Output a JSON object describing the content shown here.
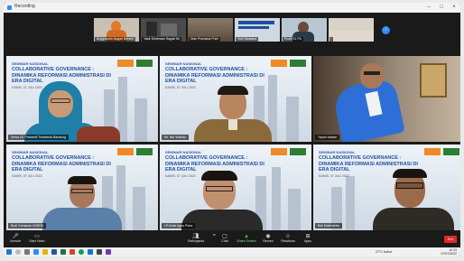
{
  "window": {
    "title": "Recording"
  },
  "strip": {
    "participants": [
      "Anggrandis Nagari Berseri",
      "Yasir Seneraan Sagati Se",
      "Dian Pramana Putri",
      "Yuni Dwisaka",
      "Prodi S1 PA",
      ""
    ]
  },
  "slide": {
    "seminar": "SEMINAR NASIONAL",
    "title": "COLLABORATIVE GOVERNANCE : DINAMIKA REFORMASI ADMINISTRASI DI ERA DIGITAL",
    "date": "KAMIS, 07 JULI 2022"
  },
  "tiles": [
    {
      "name": "Dewa Gt. Pramesti Tristwinda Bandung"
    },
    {
      "name": "Mr. Nur Widodo"
    },
    {
      "name": "Yayan Irawan"
    },
    {
      "name": "Budi Gunawan UNSRA"
    },
    {
      "name": "LR Anak Agus Putra"
    },
    {
      "name": "Bali Makisdeba"
    }
  ],
  "toolbar": {
    "unmute": "Unmute",
    "start_video": "Start Video",
    "participants": "Participants",
    "participants_count": "70",
    "chat": "Chat",
    "share_screen": "Share Screen",
    "record": "Record",
    "reactions": "Reactions",
    "apps": "Apps",
    "end": "End"
  },
  "taskbar": {
    "weather": "27°C Kabut",
    "time": "10:23",
    "date": "07/07/2022"
  },
  "colors": {
    "accent": "#2d8cff",
    "end": "#e02828",
    "title_blue": "#1f4e9e"
  }
}
